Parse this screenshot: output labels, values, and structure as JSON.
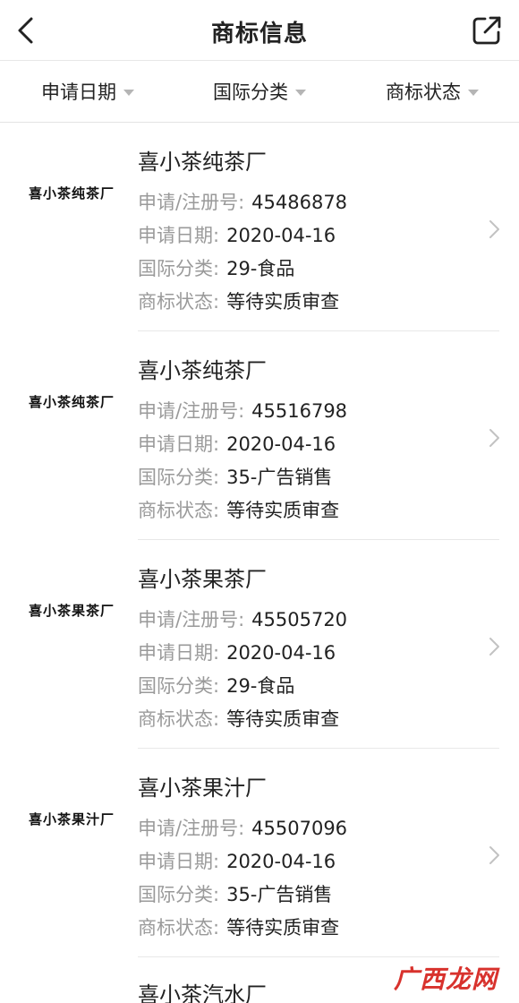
{
  "header": {
    "title": "商标信息",
    "back_icon": "back-chevron-icon",
    "share_icon": "share-external-icon"
  },
  "filters": [
    {
      "label": "申请日期"
    },
    {
      "label": "国际分类"
    },
    {
      "label": "商标状态"
    }
  ],
  "labels": {
    "reg_no": "申请/注册号:",
    "apply_date": "申请日期:",
    "intl_class": "国际分类:",
    "status": "商标状态:"
  },
  "items": [
    {
      "logo_text": "喜小茶纯茶厂",
      "name": "喜小茶纯茶厂",
      "reg_no": "45486878",
      "apply_date": "2020-04-16",
      "intl_class": "29-食品",
      "status": "等待实质审查"
    },
    {
      "logo_text": "喜小茶纯茶厂",
      "name": "喜小茶纯茶厂",
      "reg_no": "45516798",
      "apply_date": "2020-04-16",
      "intl_class": "35-广告销售",
      "status": "等待实质审查"
    },
    {
      "logo_text": "喜小茶果茶厂",
      "name": "喜小茶果茶厂",
      "reg_no": "45505720",
      "apply_date": "2020-04-16",
      "intl_class": "29-食品",
      "status": "等待实质审查"
    },
    {
      "logo_text": "喜小茶果汁厂",
      "name": "喜小茶果汁厂",
      "reg_no": "45507096",
      "apply_date": "2020-04-16",
      "intl_class": "35-广告销售",
      "status": "等待实质审查"
    }
  ],
  "partial_item": {
    "name": "喜小茶汽水厂"
  },
  "watermark": "广西龙网",
  "colors": {
    "label_gray": "#9a9a9a",
    "text_dark": "#222222",
    "divider": "#e8e8e8",
    "watermark_red": "#d8322d"
  }
}
